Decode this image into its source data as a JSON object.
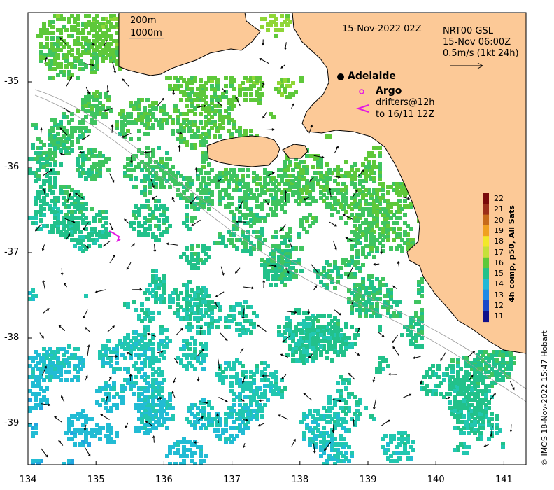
{
  "header": {
    "datetime": "15-Nov-2022 02Z",
    "scale_200": "200m",
    "scale_1000": "1000m"
  },
  "current_legend": {
    "source": "NRT00 GSL",
    "time": "15-Nov 06:00Z",
    "scale": "0.5m/s (1kt 24h)"
  },
  "places": {
    "city": "Adelaide",
    "argo": "Argo",
    "drifters_line1": "drifters@12h",
    "drifters_line2": "to 16/11 12Z"
  },
  "colorbar": {
    "title": "4h comp, p50, All Sats",
    "ticks": [
      "22",
      "21",
      "20",
      "19",
      "18",
      "17",
      "16",
      "15",
      "14",
      "13",
      "12",
      "11"
    ],
    "colors": [
      "#7a0a0a",
      "#9c2f1a",
      "#c76a1a",
      "#f0a020",
      "#f2e82a",
      "#c6e03a",
      "#5ec83a",
      "#22c18a",
      "#22b8d6",
      "#1f8ae6",
      "#1a48c8",
      "#10108a"
    ]
  },
  "axes": {
    "xticks": [
      "134",
      "135",
      "136",
      "137",
      "138",
      "139",
      "140",
      "141"
    ],
    "yticks": [
      "-35",
      "-36",
      "-37",
      "-38",
      "-39"
    ]
  },
  "credit": "© IMOS 18-Nov-2022 15:47 Hobart"
}
